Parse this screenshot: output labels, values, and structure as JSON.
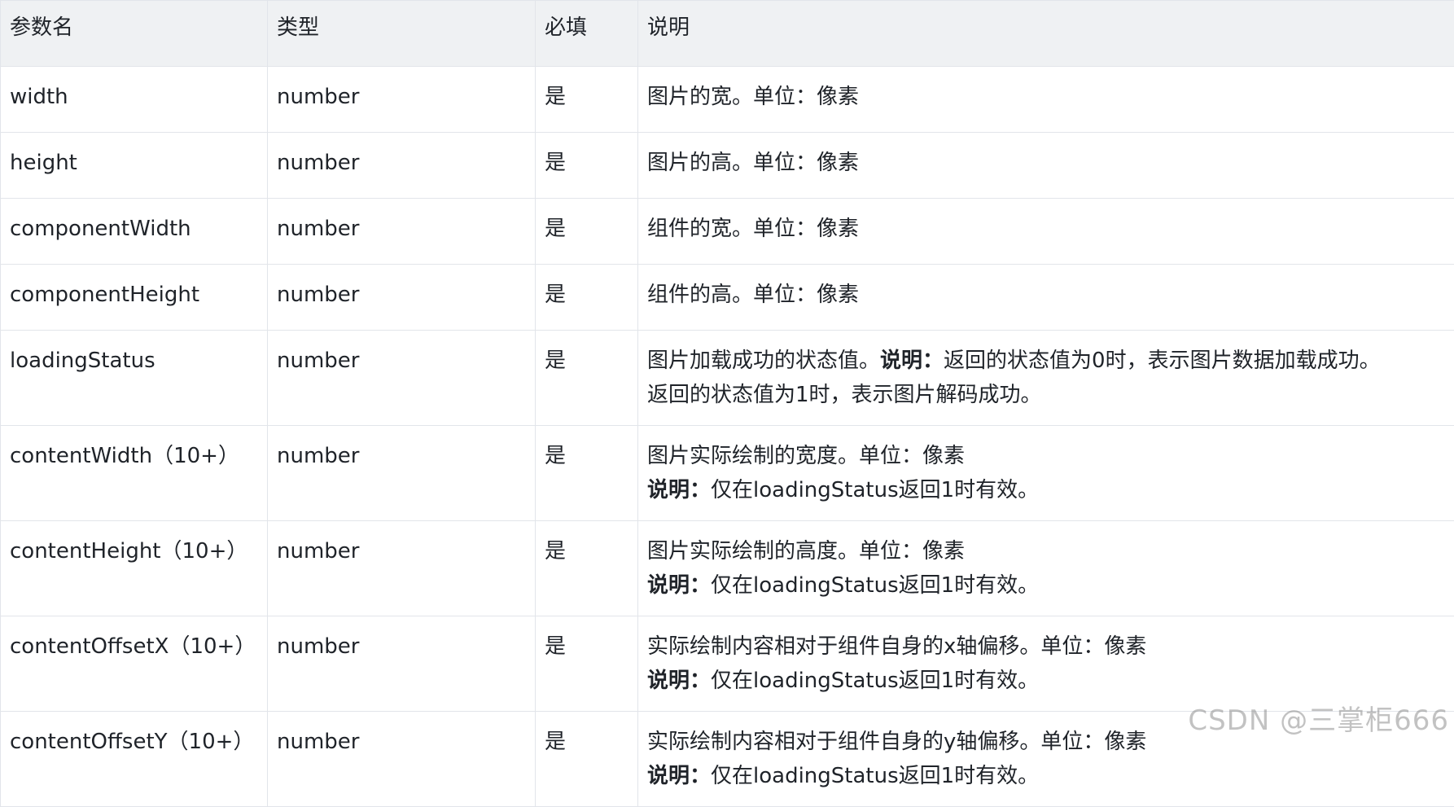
{
  "table": {
    "headers": {
      "name": "参数名",
      "type": "类型",
      "required": "必填",
      "desc": "说明"
    },
    "rows": [
      {
        "name": "width",
        "type": "number",
        "required": "是",
        "desc_line1": "图片的宽。单位：像素"
      },
      {
        "name": "height",
        "type": "number",
        "required": "是",
        "desc_line1": "图片的高。单位：像素"
      },
      {
        "name": "componentWidth",
        "type": "number",
        "required": "是",
        "desc_line1": "组件的宽。单位：像素"
      },
      {
        "name": "componentHeight",
        "type": "number",
        "required": "是",
        "desc_line1": "组件的高。单位：像素"
      },
      {
        "name": "loadingStatus",
        "type": "number",
        "required": "是",
        "desc_line1_prefix": "图片加载成功的状态值。",
        "desc_line1_bold": "说明：",
        "desc_line1_suffix": "返回的状态值为0时，表示图片数据加载成功。",
        "desc_line2": "返回的状态值为1时，表示图片解码成功。"
      },
      {
        "name": "contentWidth（10+）",
        "type": "number",
        "required": "是",
        "desc_line1": "图片实际绘制的宽度。单位：像素",
        "desc_line2_bold": "说明：",
        "desc_line2": "仅在loadingStatus返回1时有效。"
      },
      {
        "name": "contentHeight（10+）",
        "type": "number",
        "required": "是",
        "desc_line1": "图片实际绘制的高度。单位：像素",
        "desc_line2_bold": "说明：",
        "desc_line2": "仅在loadingStatus返回1时有效。"
      },
      {
        "name": "contentOffsetX（10+）",
        "type": "number",
        "required": "是",
        "desc_line1": "实际绘制内容相对于组件自身的x轴偏移。单位：像素",
        "desc_line2_bold": "说明：",
        "desc_line2": "仅在loadingStatus返回1时有效。"
      },
      {
        "name": "contentOffsetY（10+）",
        "type": "number",
        "required": "是",
        "desc_line1": "实际绘制内容相对于组件自身的y轴偏移。单位：像素",
        "desc_line2_bold": "说明：",
        "desc_line2": "仅在loadingStatus返回1时有效。"
      }
    ]
  },
  "watermark": "CSDN @三掌柜666"
}
